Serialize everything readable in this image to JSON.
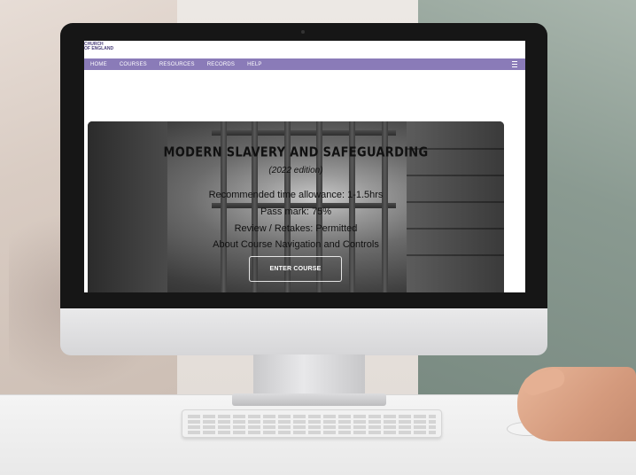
{
  "site": {
    "logo_line1": "CHURCH",
    "logo_line2": "OF ENGLAND"
  },
  "nav": {
    "items": [
      "HOME",
      "COURSES",
      "RESOURCES",
      "RECORDS",
      "HELP"
    ],
    "menu_icon": "menu-icon"
  },
  "course": {
    "title": "MODERN SLAVERY AND SAFEGUARDING",
    "edition": "(2022 edition)",
    "time": "Recommended time allowance: 1-1.5hrs",
    "pass_mark": "Pass mark: 75%",
    "review": "Review / Retakes: Permitted",
    "about": "About Course Navigation and Controls",
    "enter_label": "ENTER COURSE"
  },
  "colors": {
    "nav_bg": "#8a7bb8",
    "screen_bg": "#ffffff",
    "bezel": "#161616"
  }
}
